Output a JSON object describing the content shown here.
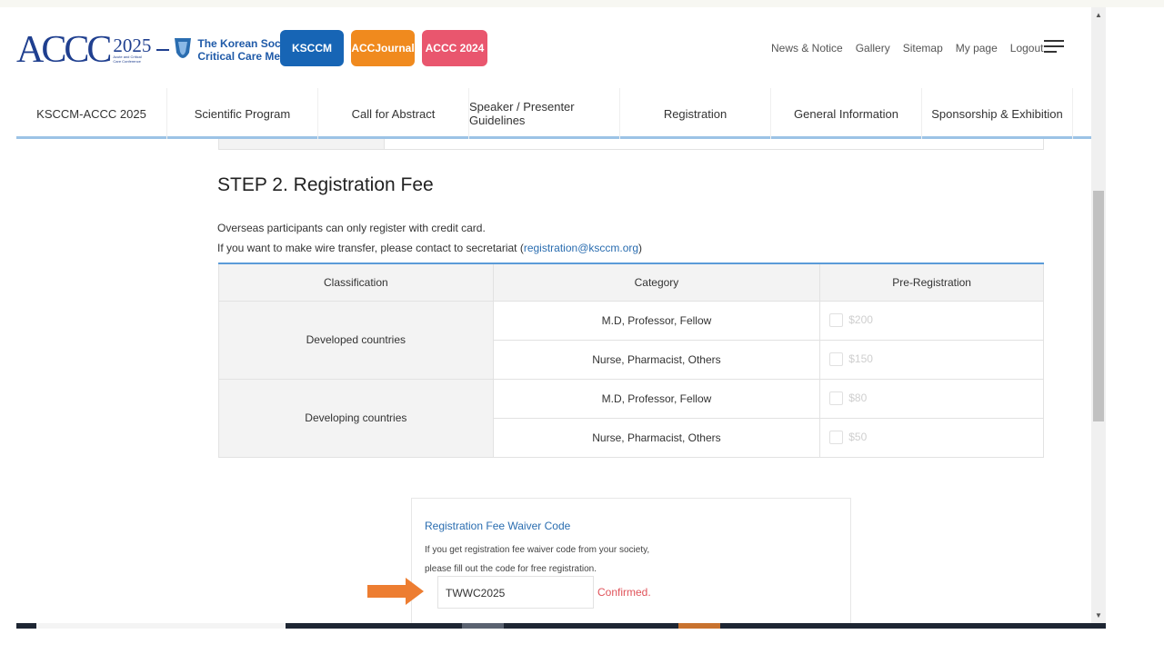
{
  "header": {
    "logo_text": "ACCC",
    "logo_year": "2025",
    "logo_subtitle": "Acute and Critical Care Conference",
    "society_line1": "The Korean Society of",
    "society_line2": "Critical Care Medicine",
    "pills": [
      "KSCCM",
      "ACCJournal",
      "ACCC 2024"
    ],
    "links": [
      "News & Notice",
      "Gallery",
      "Sitemap",
      "My page",
      "Logout"
    ]
  },
  "nav": [
    "KSCCM-ACCC 2025",
    "Scientific Program",
    "Call for Abstract",
    "Speaker / Presenter Guidelines",
    "Registration",
    "General Information",
    "Sponsorship & Exhibition"
  ],
  "step": {
    "title": "STEP 2. Registration Fee",
    "note1": "Overseas participants can only register with credit card.",
    "note2_prefix": "If you want to make wire transfer, please contact to secretariat (",
    "email": "registration@ksccm.org",
    "note2_suffix": ")"
  },
  "table": {
    "headers": [
      "Classification",
      "Category",
      "Pre-Registration"
    ],
    "groups": [
      {
        "classification": "Developed countries",
        "rows": [
          {
            "category": "M.D, Professor, Fellow",
            "price": "$200"
          },
          {
            "category": "Nurse, Pharmacist, Others",
            "price": "$150"
          }
        ]
      },
      {
        "classification": "Developing countries",
        "rows": [
          {
            "category": "M.D, Professor, Fellow",
            "price": "$80"
          },
          {
            "category": "Nurse, Pharmacist, Others",
            "price": "$50"
          }
        ]
      }
    ]
  },
  "waiver": {
    "title": "Registration Fee Waiver Code",
    "desc1": "If you get registration fee waiver code from your society,",
    "desc2": "please fill out the code for free registration.",
    "code_value": "TWWC2025",
    "status": "Confirmed."
  },
  "colors": {
    "accent": "#5a9bd8",
    "ksccm": "#1765b5",
    "journal": "#f08a1e",
    "accc": "#e9566e",
    "arrow": "#ed7d31",
    "confirmed": "#e0535a"
  }
}
